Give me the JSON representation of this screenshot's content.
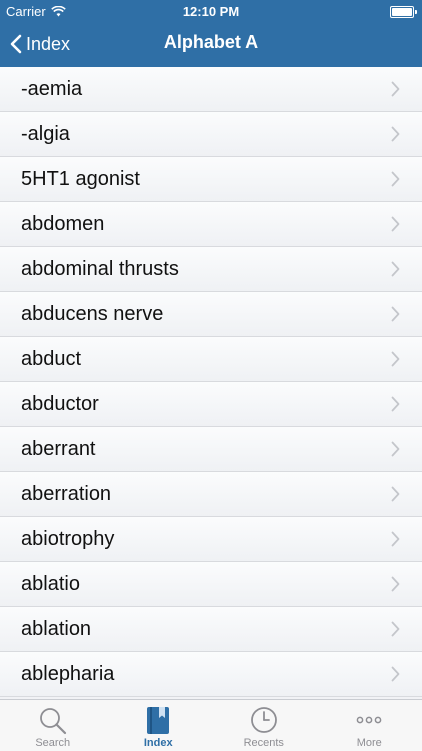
{
  "status": {
    "carrier": "Carrier",
    "time": "12:10 PM"
  },
  "nav": {
    "back_label": "Index",
    "title": "Alphabet A"
  },
  "list": {
    "items": [
      "-aemia",
      "-algia",
      "5HT1 agonist",
      "abdomen",
      "abdominal thrusts",
      "abducens nerve",
      "abduct",
      "abductor",
      "aberrant",
      "aberration",
      "abiotrophy",
      "ablatio",
      "ablation",
      "ablepharia"
    ]
  },
  "tabbar": {
    "tabs": [
      {
        "label": "Search",
        "icon": "search-icon",
        "active": false
      },
      {
        "label": "Index",
        "icon": "book-icon",
        "active": true
      },
      {
        "label": "Recents",
        "icon": "clock-icon",
        "active": false
      },
      {
        "label": "More",
        "icon": "more-icon",
        "active": false
      }
    ]
  },
  "colors": {
    "nav_bg": "#2f6fa6",
    "active_tab": "#2f6fa6",
    "inactive_tab": "#8e8e93"
  }
}
